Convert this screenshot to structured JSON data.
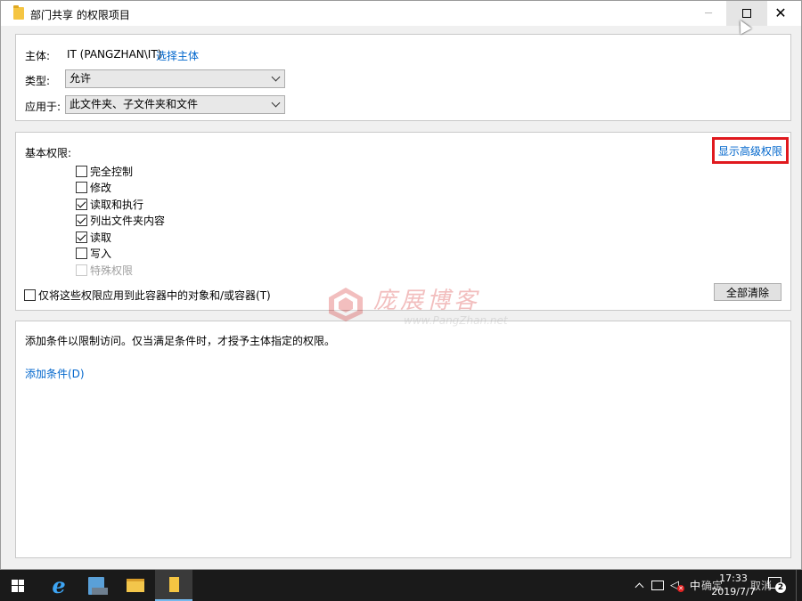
{
  "window": {
    "title": "部门共享 的权限项目"
  },
  "principal": {
    "label": "主体:",
    "value": "IT (PANGZHAN\\IT)",
    "select_link": "选择主体"
  },
  "type": {
    "label": "类型:",
    "value": "允许"
  },
  "applies_to": {
    "label": "应用于:",
    "value": "此文件夹、子文件夹和文件"
  },
  "basic_permissions": {
    "label": "基本权限:",
    "show_advanced": "显示高级权限",
    "items": [
      {
        "label": "完全控制",
        "checked": false,
        "disabled": false
      },
      {
        "label": "修改",
        "checked": false,
        "disabled": false
      },
      {
        "label": "读取和执行",
        "checked": true,
        "disabled": false
      },
      {
        "label": "列出文件夹内容",
        "checked": true,
        "disabled": false
      },
      {
        "label": "读取",
        "checked": true,
        "disabled": false
      },
      {
        "label": "写入",
        "checked": false,
        "disabled": false
      },
      {
        "label": "特殊权限",
        "checked": false,
        "disabled": true
      }
    ],
    "apply_only_label": "仅将这些权限应用到此容器中的对象和/或容器(T)",
    "clear_all": "全部清除"
  },
  "conditions": {
    "description": "添加条件以限制访问。仅当满足条件时，才授予主体指定的权限。",
    "add_link": "添加条件(D)"
  },
  "watermark": {
    "name": "庞展博客",
    "url": "www.PangZhan.net"
  },
  "taskbar": {
    "ime": "中",
    "time": "17:33",
    "date": "2019/7/7",
    "notify_count": "2",
    "behind_text_1": "确定",
    "behind_text_2": "取消"
  },
  "colors": {
    "link": "#0066cc",
    "highlight": "#e0191e",
    "taskbar": "#1a1a1a"
  }
}
